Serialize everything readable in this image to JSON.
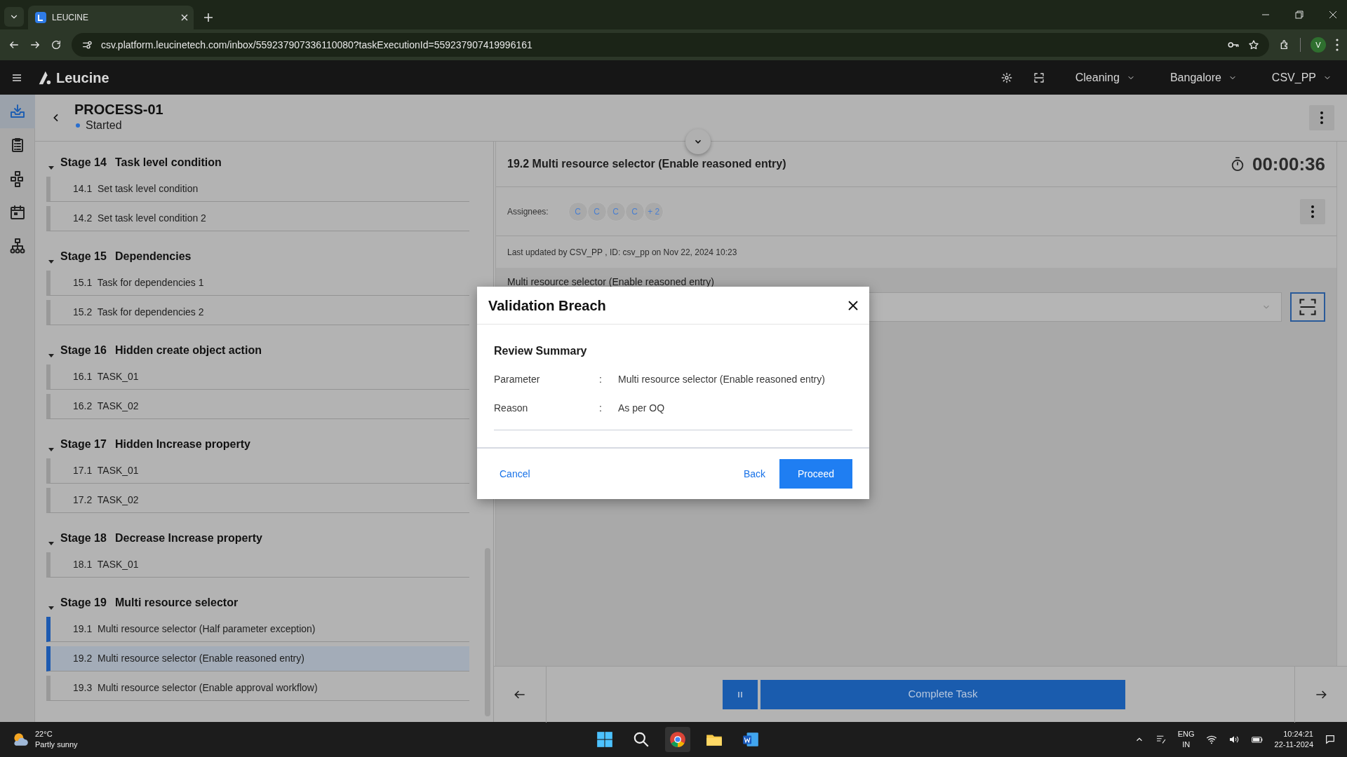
{
  "browser": {
    "tab_title": "LEUCINE",
    "url": "csv.platform.leucinetech.com/inbox/559237907336110080?taskExecutionId=559237907419996161",
    "profile_initial": "V"
  },
  "app_header": {
    "brand": "Leucine",
    "menus": [
      {
        "label": "Cleaning"
      },
      {
        "label": "Bangalore"
      },
      {
        "label": "CSV_PP"
      }
    ]
  },
  "sidebar": {
    "items": [
      {
        "kind": "inbox",
        "selected": true
      },
      {
        "kind": "clipboard",
        "selected": false
      },
      {
        "kind": "flow",
        "selected": false
      },
      {
        "kind": "calendar",
        "selected": false
      },
      {
        "kind": "hierarchy",
        "selected": false
      }
    ]
  },
  "process": {
    "title": "PROCESS-01",
    "status": "Started"
  },
  "stages": [
    {
      "number": "Stage 14",
      "title": "Task level condition",
      "expanded": true,
      "tasks": [
        {
          "number": "14.1",
          "title": "Set task level condition",
          "selected": false,
          "in_progress": false
        },
        {
          "number": "14.2",
          "title": "Set task level condition 2",
          "selected": false,
          "in_progress": false
        }
      ]
    },
    {
      "number": "Stage 15",
      "title": "Dependencies",
      "expanded": true,
      "tasks": [
        {
          "number": "15.1",
          "title": "Task for dependencies 1",
          "selected": false,
          "in_progress": false
        },
        {
          "number": "15.2",
          "title": "Task for dependencies 2",
          "selected": false,
          "in_progress": false
        }
      ]
    },
    {
      "number": "Stage 16",
      "title": "Hidden create object action",
      "expanded": true,
      "tasks": [
        {
          "number": "16.1",
          "title": "TASK_01",
          "selected": false,
          "in_progress": false
        },
        {
          "number": "16.2",
          "title": "TASK_02",
          "selected": false,
          "in_progress": false
        }
      ]
    },
    {
      "number": "Stage 17",
      "title": "Hidden Increase property",
      "expanded": true,
      "tasks": [
        {
          "number": "17.1",
          "title": "TASK_01",
          "selected": false,
          "in_progress": false
        },
        {
          "number": "17.2",
          "title": "TASK_02",
          "selected": false,
          "in_progress": false
        }
      ]
    },
    {
      "number": "Stage 18",
      "title": "Decrease Increase property",
      "expanded": true,
      "tasks": [
        {
          "number": "18.1",
          "title": "TASK_01",
          "selected": false,
          "in_progress": false
        }
      ]
    },
    {
      "number": "Stage 19",
      "title": "Multi resource selector",
      "expanded": true,
      "tasks": [
        {
          "number": "19.1",
          "title": "Multi resource selector (Half parameter exception)",
          "selected": false,
          "in_progress": true
        },
        {
          "number": "19.2",
          "title": "Multi resource selector (Enable reasoned entry)",
          "selected": true,
          "in_progress": true
        },
        {
          "number": "19.3",
          "title": "Multi resource selector (Enable approval workflow)",
          "selected": false,
          "in_progress": false
        }
      ]
    }
  ],
  "task": {
    "title": "19.2 Multi resource selector (Enable reasoned entry)",
    "timer": "00:00:36",
    "assignees_label": "Assignees:",
    "assignees": [
      "C",
      "C",
      "C",
      "C"
    ],
    "more_assignees": "+ 2",
    "last_updated": "Last updated by CSV_PP , ID: csv_pp on Nov 22, 2024 10:23",
    "parameter_label": "Multi resource selector (Enable reasoned entry)"
  },
  "footer": {
    "complete_button": "Complete Task"
  },
  "modal": {
    "title": "Validation Breach",
    "section": "Review Summary",
    "rows": [
      {
        "label": "Parameter",
        "separator": ":",
        "value": "Multi resource selector (Enable reasoned entry)"
      },
      {
        "label": "Reason",
        "separator": ":",
        "value": "As per OQ"
      }
    ],
    "cancel": "Cancel",
    "back": "Back",
    "proceed": "Proceed"
  },
  "taskbar": {
    "temperature": "22°C",
    "weather": "Partly sunny",
    "language": "ENG",
    "region": "IN",
    "time": "10:24:21",
    "date": "22-11-2024"
  }
}
